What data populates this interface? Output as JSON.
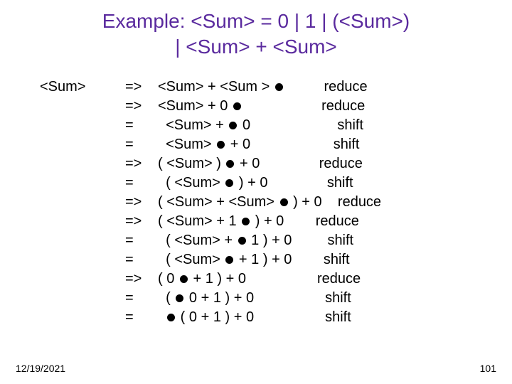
{
  "title_line1": "Example: <Sum> = 0 | 1 | (<Sum>)",
  "title_line2": "| <Sum> + <Sum>",
  "left_label": "<Sum>",
  "rows": [
    {
      "op": "=>",
      "pre": "<Sum> + <Sum > ",
      "post": "",
      "pad": "          ",
      "action": "reduce"
    },
    {
      "op": "=>",
      "pre": "<Sum> + 0 ",
      "post": "",
      "pad": "                    ",
      "action": "reduce"
    },
    {
      "op": "=",
      "pre": "  <Sum> + ",
      "post": " 0",
      "pad": "                      ",
      "action": "shift"
    },
    {
      "op": "=",
      "pre": "  <Sum> ",
      "post": " + 0",
      "pad": "                     ",
      "action": "shift"
    },
    {
      "op": "=>",
      "pre": "( <Sum> ) ",
      "post": " + 0",
      "pad": "               ",
      "action": "reduce"
    },
    {
      "op": "=",
      "pre": "  ( <Sum> ",
      "post": " ) + 0",
      "pad": "               ",
      "action": "shift"
    },
    {
      "op": "=>",
      "pre": "( <Sum> + <Sum> ",
      "post": " ) + 0",
      "pad": "    ",
      "action": "reduce"
    },
    {
      "op": "=>",
      "pre": "( <Sum> + 1 ",
      "post": " ) + 0",
      "pad": "        ",
      "action": "reduce"
    },
    {
      "op": "=",
      "pre": "  ( <Sum> + ",
      "post": " 1 ) + 0",
      "pad": "         ",
      "action": "shift"
    },
    {
      "op": "=",
      "pre": "  ( <Sum> ",
      "post": " + 1 ) + 0",
      "pad": "        ",
      "action": "shift"
    },
    {
      "op": "=>",
      "pre": "( 0 ",
      "post": " + 1 ) + 0",
      "pad": "                  ",
      "action": "reduce"
    },
    {
      "op": "=",
      "pre": "  ( ",
      "post": " 0 + 1 ) + 0",
      "pad": "                  ",
      "action": "shift"
    },
    {
      "op": "=",
      "pre": "  ",
      "post": " ( 0 + 1 ) + 0",
      "pad": "                  ",
      "action": "shift"
    }
  ],
  "footer_date": "12/19/2021",
  "footer_page": "101"
}
